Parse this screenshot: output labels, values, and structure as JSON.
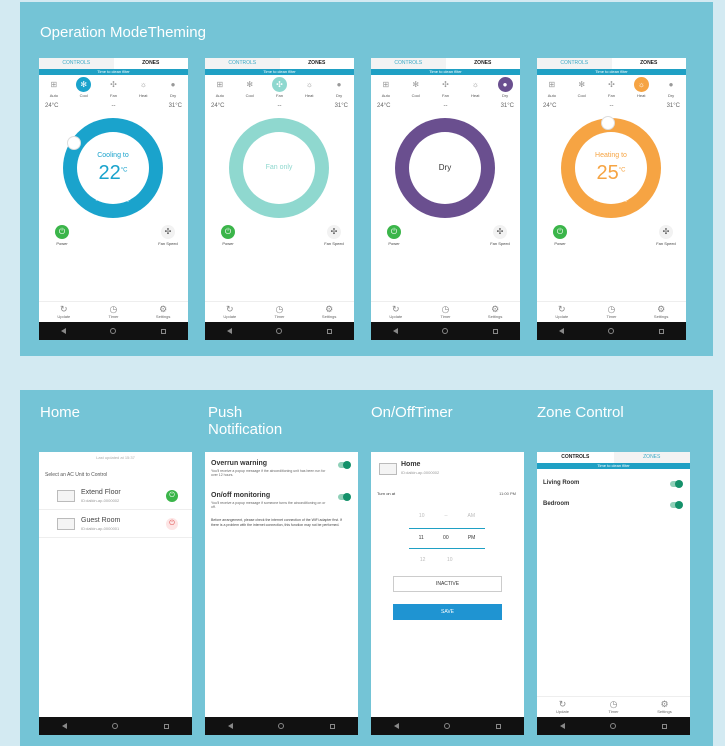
{
  "sections": {
    "top_title": "Operation ModeTheming",
    "home_title": "Home",
    "push_title": "Push Notification",
    "timer_title": "On/OffTimer",
    "zone_title": "Zone Control"
  },
  "tabs": {
    "controls": "CONTROLS",
    "zones": "ZONES"
  },
  "filter_banner": "Time to clean filter",
  "modes": [
    "Auto",
    "Cool",
    "Fan",
    "Heat",
    "Dry"
  ],
  "mode_icons": [
    "grid-icon",
    "snowflake-icon",
    "fan-icon",
    "sun-icon",
    "droplet-icon"
  ],
  "readouts": {
    "indoor": "24°C",
    "humidity": "--",
    "outdoor": "31°C"
  },
  "screens": {
    "cool": {
      "status": "Cooling to",
      "temp": "22",
      "unit": "°C",
      "color": "#1aa3cc"
    },
    "fan": {
      "status": "Fan only",
      "color": "#8fd8cf"
    },
    "dry": {
      "status": "Dry",
      "color": "#6a4f8f"
    },
    "heat": {
      "status": "Heating to",
      "temp": "25",
      "unit": "°C",
      "color": "#f6a443"
    }
  },
  "controls": {
    "power": "Power",
    "fan_speed": "Fan Speed"
  },
  "bottom_nav": [
    "Update",
    "Timer",
    "Settings"
  ],
  "home": {
    "header": "Last updated at 15:37",
    "prompt": "Select an AC Unit to Control",
    "units": [
      {
        "name": "Extend Floor",
        "id": "ID:daikin-ap-0000002"
      },
      {
        "name": "Guest Room",
        "id": "ID:daikin-ap-0000001"
      }
    ]
  },
  "push": {
    "items": [
      {
        "title": "Overrun warning",
        "desc": "You'll receive a popup message if the airconditioning unit has been run for over 12 hours."
      },
      {
        "title": "On/off monitoring",
        "desc": "You'll receive a popup message if someone turns the airconditioning on or off."
      }
    ],
    "note": "Before arrangement, please check the internet connection of the WiFi adapter first. If there is a problem with the internet connection, this function may not be performed."
  },
  "timer": {
    "title": "Home",
    "id": "ID:daikin-ap-0000002",
    "turn_on": "Turn on at",
    "time": "11:00 PM",
    "picker": {
      "hour_prev": "10",
      "min_prev": "--",
      "ampm_prev": "AM",
      "hour": "11",
      "min": "00",
      "ampm": "PM",
      "hour_next": "12",
      "min_next": "10"
    },
    "inactive": "INACTIVE",
    "save": "SAVE"
  },
  "zones": {
    "items": [
      "Living Room",
      "Bedroom"
    ]
  }
}
